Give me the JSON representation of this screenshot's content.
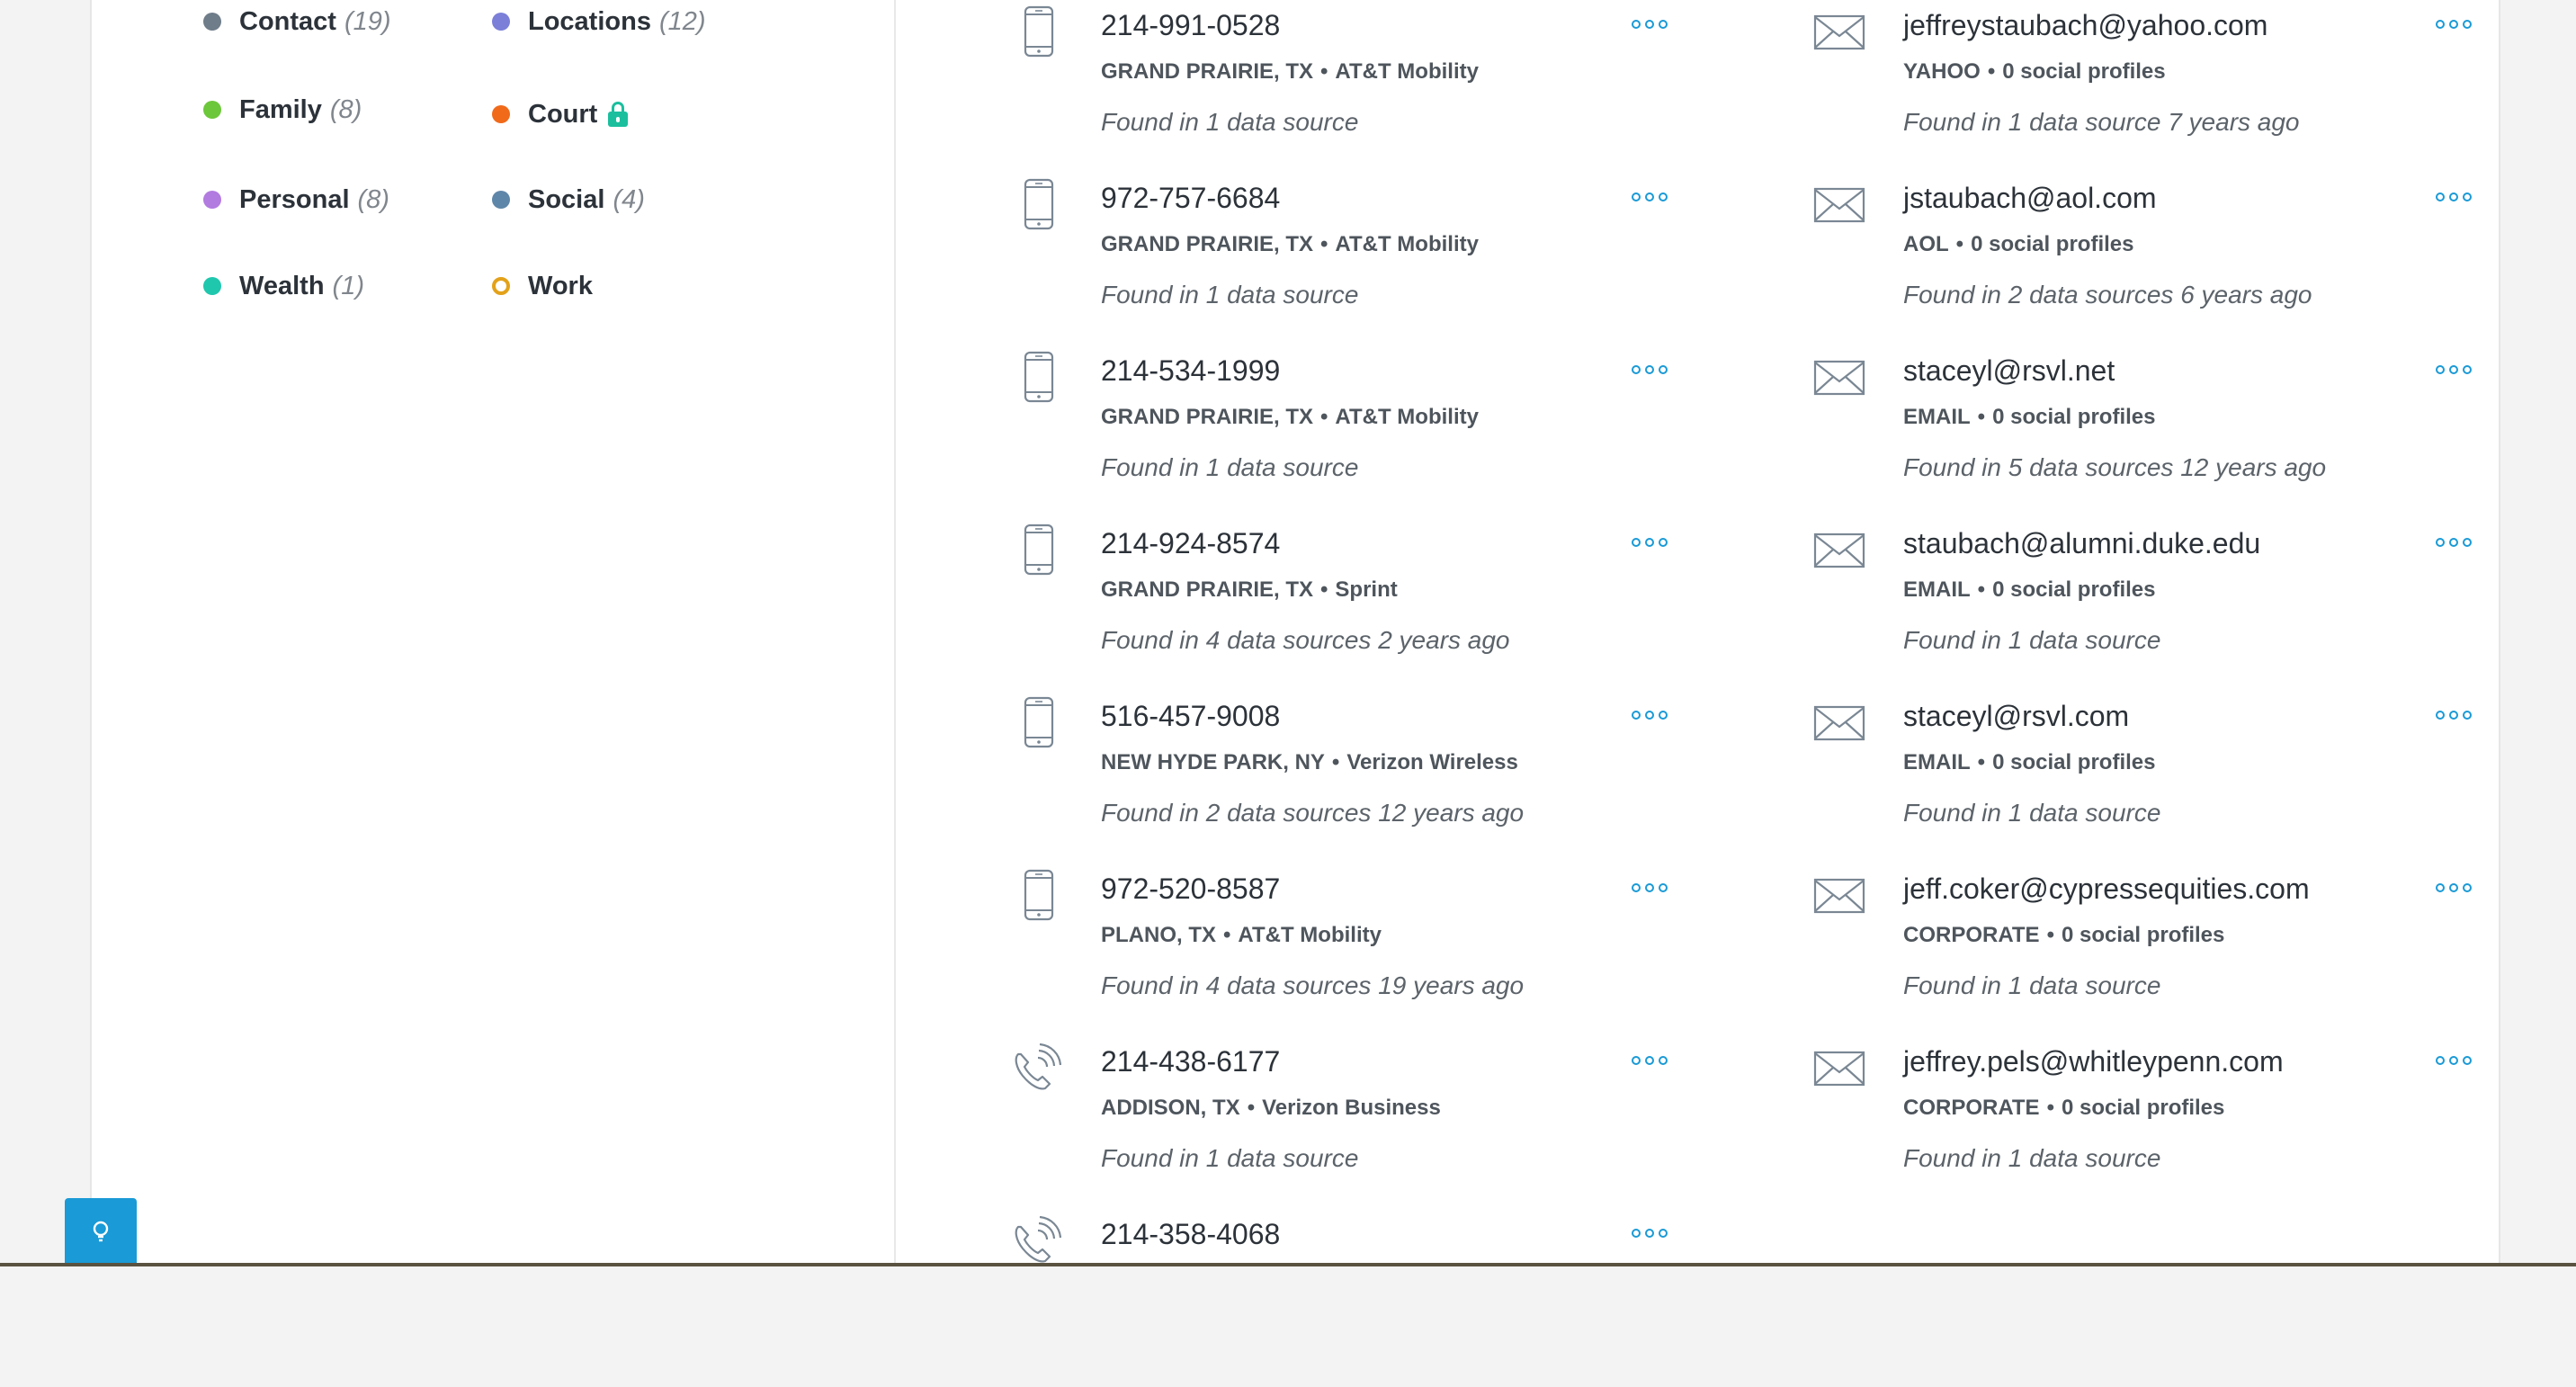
{
  "categories": [
    {
      "label": "Contact",
      "count": "(19)",
      "color": "#6f7c89"
    },
    {
      "label": "Locations",
      "count": "(12)",
      "color": "#7b7fd8"
    },
    {
      "label": "Family",
      "count": "(8)",
      "color": "#6cc73a"
    },
    {
      "label": "Court",
      "count": "",
      "color": "#f06a1a",
      "locked": true
    },
    {
      "label": "Personal",
      "count": "(8)",
      "color": "#b27be0"
    },
    {
      "label": "Social",
      "count": "(4)",
      "color": "#5e86a8"
    },
    {
      "label": "Wealth",
      "count": "(1)",
      "color": "#1fc7ad"
    },
    {
      "label": "Work",
      "count": "",
      "color": "#e3a21a",
      "ring": true
    }
  ],
  "phones": [
    {
      "number": "214-991-0528",
      "location": "GRAND PRAIRIE, TX",
      "carrier": "AT&T Mobility",
      "found": "Found in 1 data source",
      "icon": "mobile-phone-icon"
    },
    {
      "number": "972-757-6684",
      "location": "GRAND PRAIRIE, TX",
      "carrier": "AT&T Mobility",
      "found": "Found in 1 data source",
      "icon": "mobile-phone-icon"
    },
    {
      "number": "214-534-1999",
      "location": "GRAND PRAIRIE, TX",
      "carrier": "AT&T Mobility",
      "found": "Found in 1 data source",
      "icon": "mobile-phone-icon"
    },
    {
      "number": "214-924-8574",
      "location": "GRAND PRAIRIE, TX",
      "carrier": "Sprint",
      "found": "Found in 4 data sources 2 years ago",
      "icon": "mobile-phone-icon"
    },
    {
      "number": "516-457-9008",
      "location": "NEW HYDE PARK, NY",
      "carrier": "Verizon Wireless",
      "found": "Found in 2 data sources 12 years ago",
      "icon": "mobile-phone-icon"
    },
    {
      "number": "972-520-8587",
      "location": "PLANO, TX",
      "carrier": "AT&T Mobility",
      "found": "Found in 4 data sources 19 years ago",
      "icon": "mobile-phone-icon"
    },
    {
      "number": "214-438-6177",
      "location": "ADDISON, TX",
      "carrier": "Verizon Business",
      "found": "Found in 1 data source",
      "icon": "landline-phone-icon"
    },
    {
      "number": "214-358-4068",
      "location": "",
      "carrier": "",
      "found": "",
      "icon": "landline-phone-icon"
    }
  ],
  "emails": [
    {
      "address": "jeffreystaubach@yahoo.com",
      "type": "YAHOO",
      "profiles": "0 social profiles",
      "found": "Found in 1 data source 7 years ago"
    },
    {
      "address": "jstaubach@aol.com",
      "type": "AOL",
      "profiles": "0 social profiles",
      "found": "Found in 2 data sources 6 years ago"
    },
    {
      "address": "staceyl@rsvl.net",
      "type": "EMAIL",
      "profiles": "0 social profiles",
      "found": "Found in 5 data sources 12 years ago"
    },
    {
      "address": "staubach@alumni.duke.edu",
      "type": "EMAIL",
      "profiles": "0 social profiles",
      "found": "Found in 1 data source"
    },
    {
      "address": "staceyl@rsvl.com",
      "type": "EMAIL",
      "profiles": "0 social profiles",
      "found": "Found in 1 data source"
    },
    {
      "address": "jeff.coker@cypressequities.com",
      "type": "CORPORATE",
      "profiles": "0 social profiles",
      "found": "Found in 1 data source"
    },
    {
      "address": "jeffrey.pels@whitleypenn.com",
      "type": "CORPORATE",
      "profiles": "0 social profiles",
      "found": "Found in 1 data source"
    }
  ],
  "colors": {
    "accent": "#1a9ad6",
    "lock": "#1bbf9e"
  }
}
